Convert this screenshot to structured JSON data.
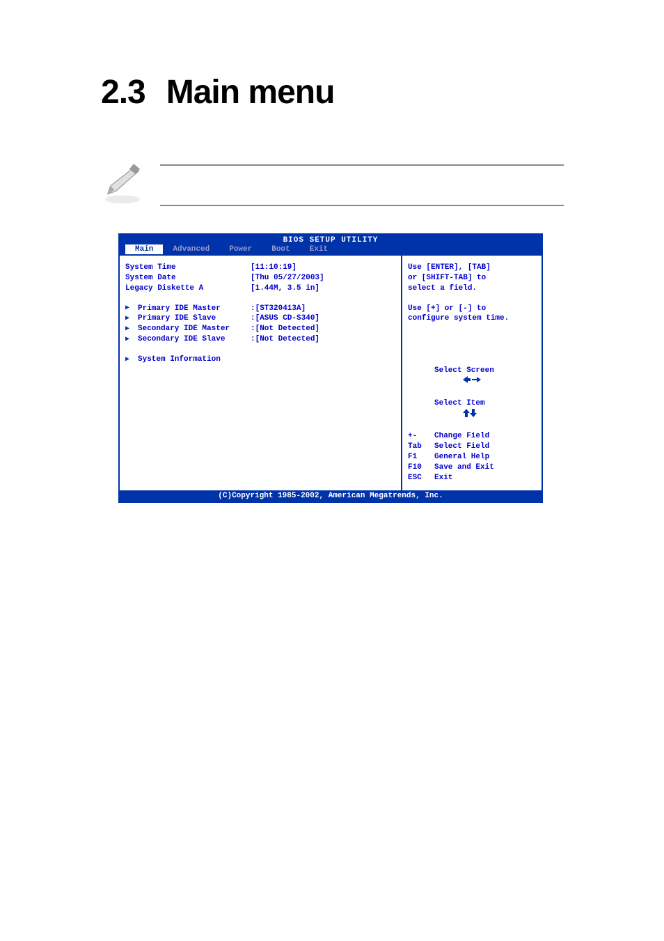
{
  "section": {
    "number": "2.3",
    "title": "Main menu"
  },
  "bios": {
    "title": "BIOS SETUP UTILITY",
    "tabs": {
      "main": "Main",
      "advanced": "Advanced",
      "power": "Power",
      "boot": "Boot",
      "exit": "Exit"
    },
    "fields": {
      "system_time": {
        "label": "System Time",
        "value": "[11:10:19]"
      },
      "system_date": {
        "label": "System Date",
        "value": "[Thu 05/27/2003]"
      },
      "legacy_diskette_a": {
        "label": "Legacy Diskette A",
        "value": "[1.44M, 3.5 in]"
      }
    },
    "submenus": {
      "primary_ide_master": {
        "label": "Primary IDE Master",
        "value": ":[ST320413A]"
      },
      "primary_ide_slave": {
        "label": "Primary IDE Slave",
        "value": ":[ASUS CD-S340]"
      },
      "secondary_ide_master": {
        "label": "Secondary IDE Master",
        "value": ":[Not Detected]"
      },
      "secondary_ide_slave": {
        "label": "Secondary IDE Slave",
        "value": ":[Not Detected]"
      },
      "system_information": {
        "label": "System Information"
      }
    },
    "help": {
      "line1": "Use [ENTER], [TAB]",
      "line2": "or [SHIFT-TAB] to",
      "line3": "select a field.",
      "line4": "Use [+] or [-] to",
      "line5": "configure system time."
    },
    "keymap": {
      "arrows_lr": {
        "key_icon": "arrows-lr",
        "action": "Select Screen"
      },
      "arrows_ud": {
        "key_icon": "arrows-ud",
        "action": "Select Item"
      },
      "plusminus": {
        "key": "+-",
        "action": "Change Field"
      },
      "tab": {
        "key": "Tab",
        "action": "Select Field"
      },
      "f1": {
        "key": "F1",
        "action": "General Help"
      },
      "f10": {
        "key": "F10",
        "action": "Save and Exit"
      },
      "esc": {
        "key": "ESC",
        "action": "Exit"
      }
    },
    "footer": "(C)Copyright 1985-2002, American Megatrends, Inc."
  }
}
